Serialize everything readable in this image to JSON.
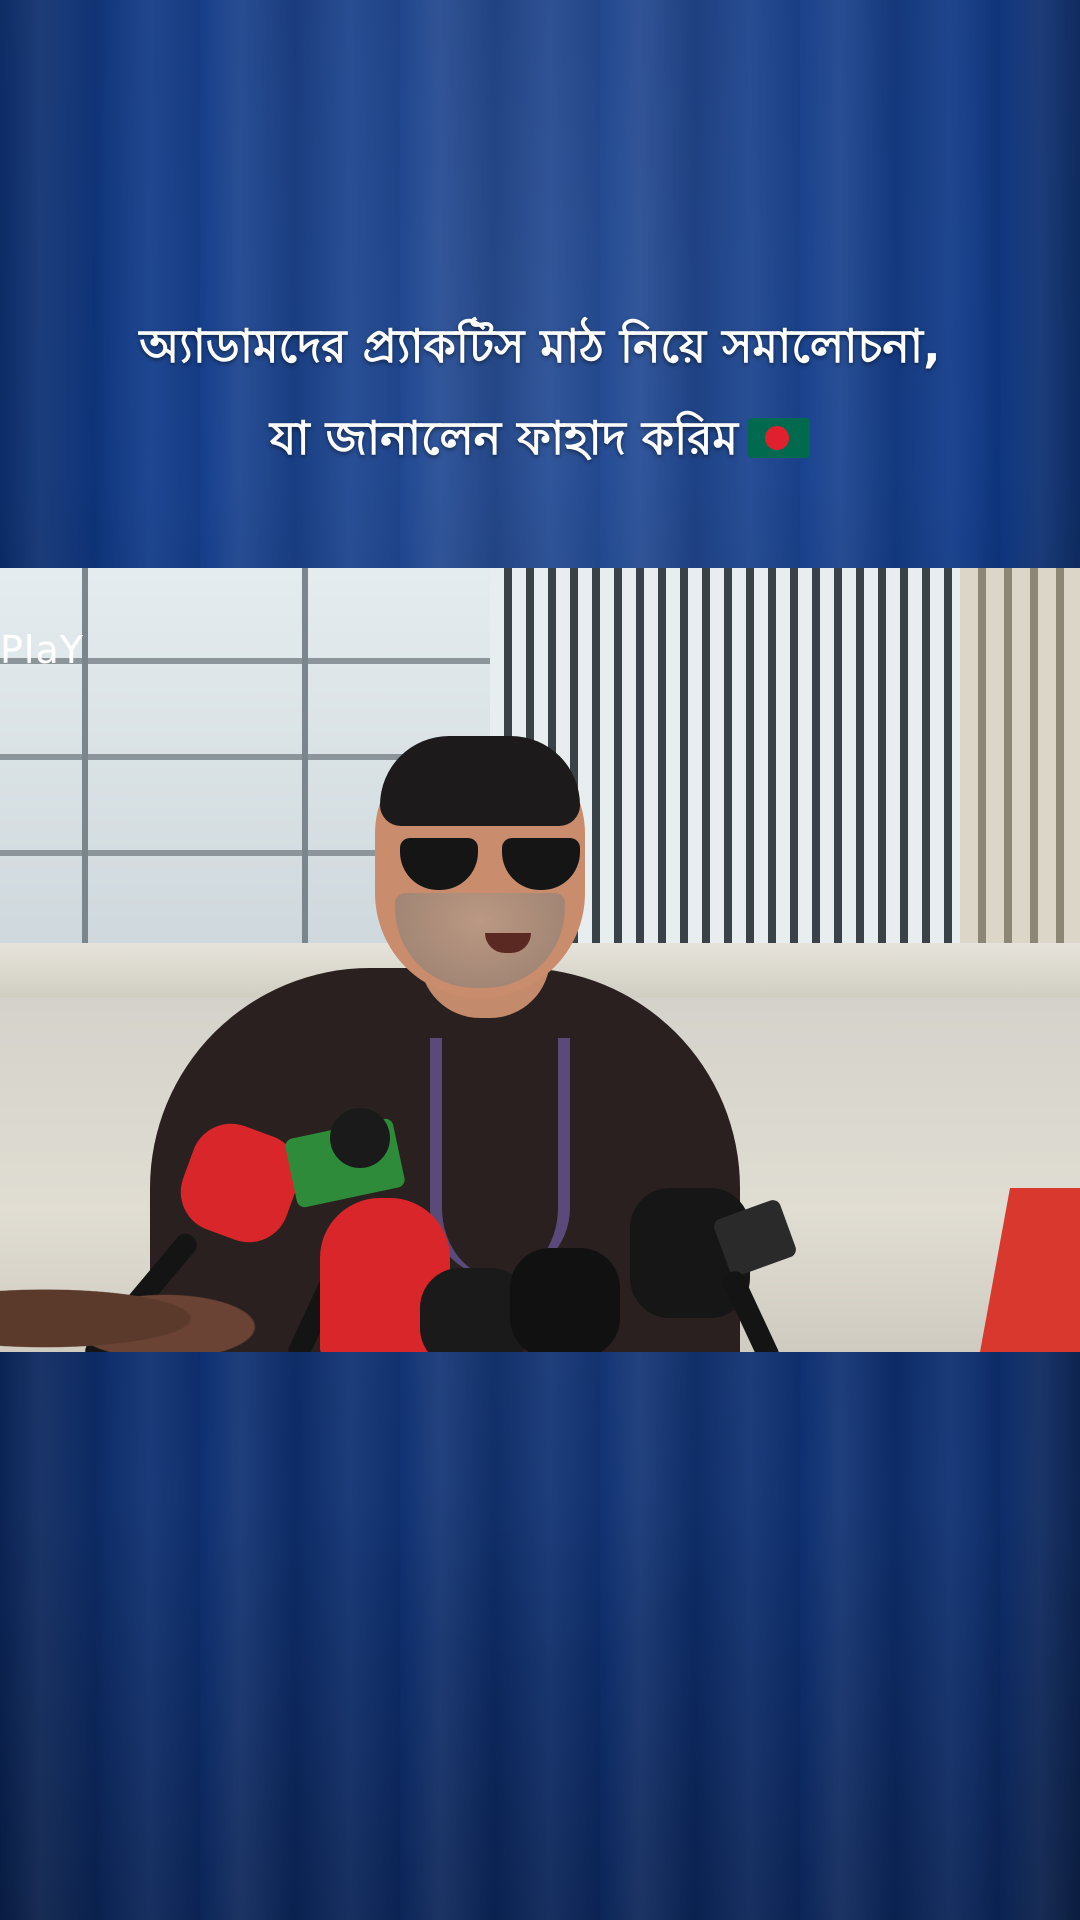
{
  "headline": {
    "line1": "অ্যাডামদের প্র্যাকটিস মাঠ নিয়ে সমালোচনা,",
    "line2": "যা জানালেন ফাহাদ করিম"
  },
  "video": {
    "watermark": "PlaY"
  },
  "icons": {
    "flag": "bangladesh-flag-icon"
  },
  "colors": {
    "background": "#0f3a8a",
    "headline_text": "#ffffff",
    "flag_green": "#006a4e",
    "flag_red": "#e0202f"
  }
}
